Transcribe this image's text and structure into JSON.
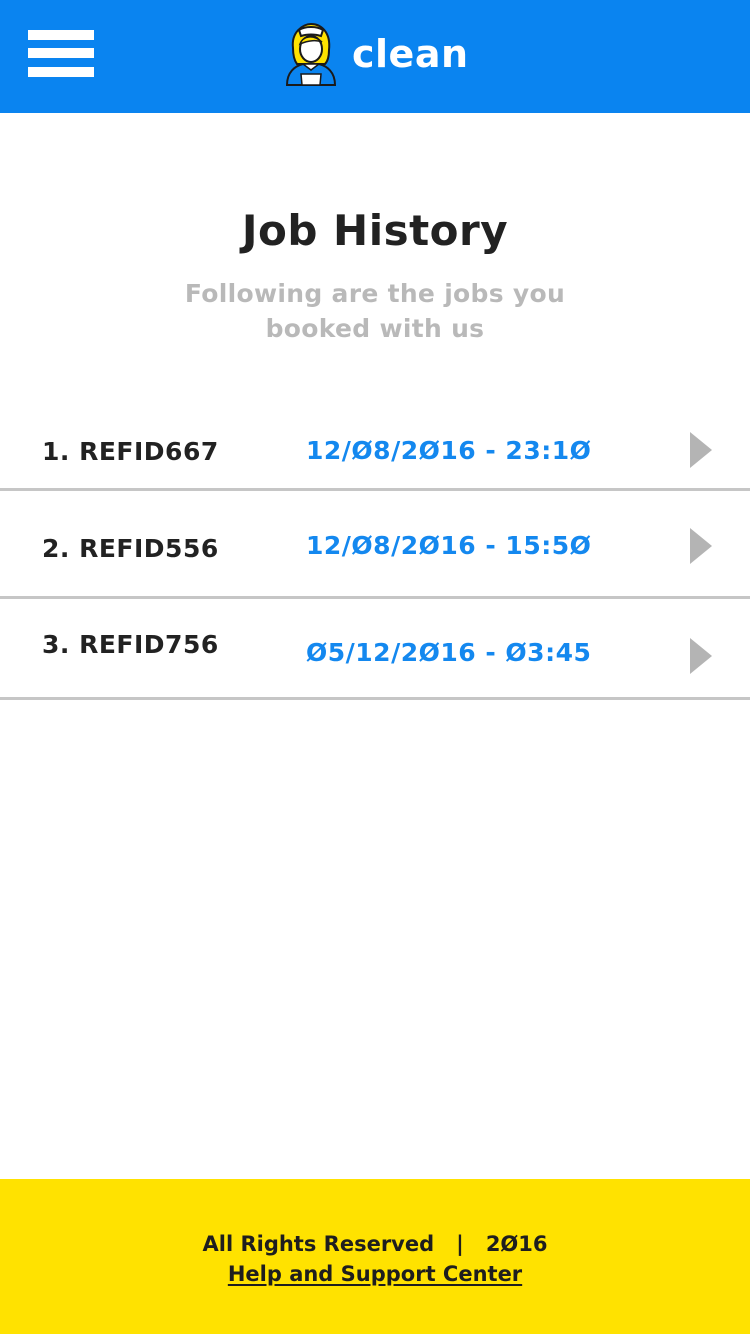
{
  "header": {
    "app_name": "clean",
    "background_color": "#0a84f0",
    "menu_icon": "hamburger-menu-icon",
    "logo_icon": "maid-mascot-icon"
  },
  "page": {
    "title": "Job History",
    "subtitle": "Following are the jobs you booked with us"
  },
  "jobs": [
    {
      "label": "1. REFID667",
      "datetime": "12/Ø8/2Ø16 - 23:1Ø",
      "icon": "chevron-right-icon"
    },
    {
      "label": "2. REFID556",
      "datetime": "12/Ø8/2Ø16 - 15:5Ø",
      "icon": "chevron-right-icon"
    },
    {
      "label": "3. REFID756",
      "datetime": "Ø5/12/2Ø16 - Ø3:45",
      "icon": "chevron-right-icon"
    }
  ],
  "footer": {
    "rights": "All Rights Reserved",
    "separator": "|",
    "year": "2Ø16",
    "help_link": "Help and Support Center",
    "background_color": "#ffe200"
  },
  "colors": {
    "accent_blue": "#1488ef",
    "subtitle_gray": "#b9b9b9",
    "divider_gray": "#c6c6c6"
  }
}
